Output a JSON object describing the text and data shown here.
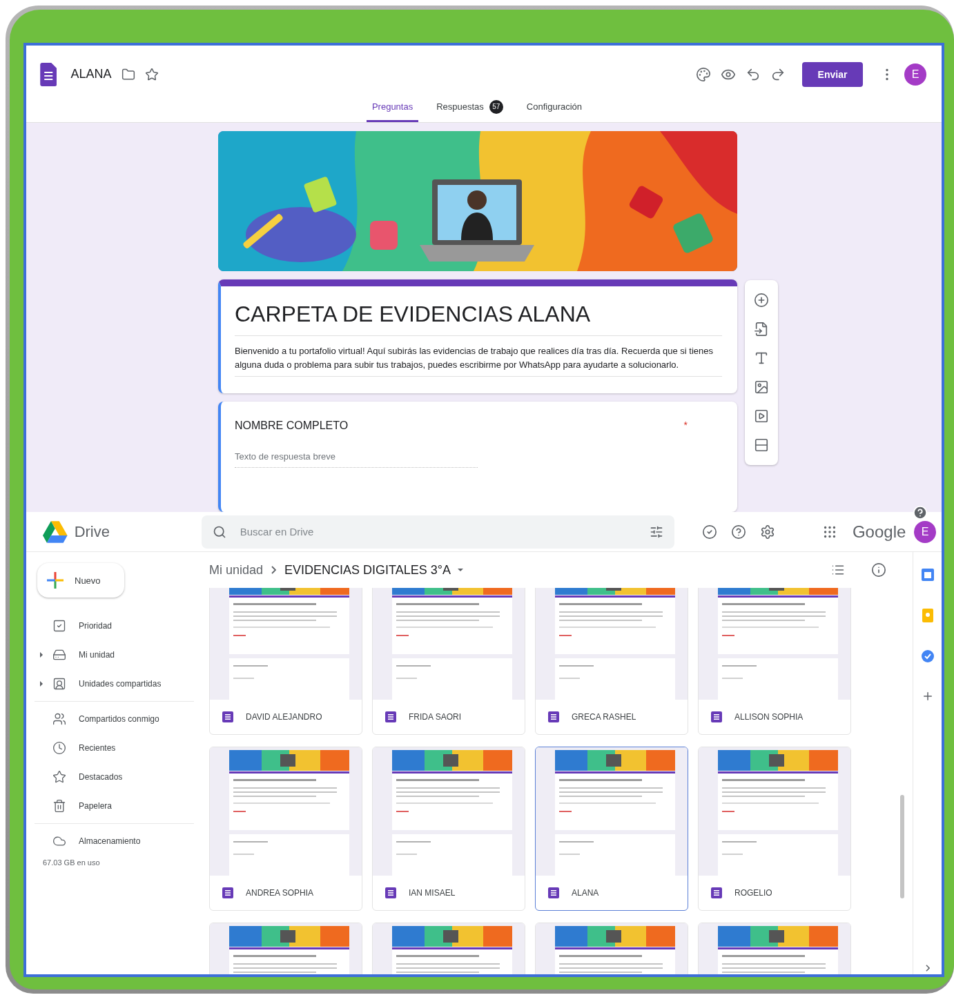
{
  "forms": {
    "title": "ALANA",
    "send_button": "Enviar",
    "avatar": "E",
    "tabs": [
      {
        "label": "Preguntas",
        "selected": true
      },
      {
        "label": "Respuestas",
        "badge": "57",
        "selected": false
      },
      {
        "label": "Configuración",
        "selected": false
      }
    ],
    "form_title": "CARPETA DE EVIDENCIAS ALANA",
    "form_description": "Bienvenido a tu portafolio virtual! Aquí subirás las evidencias de trabajo que realices día tras día. Recuerda que si tienes alguna duda o problema para subir tus trabajos, puedes escribirme por WhatsApp para ayudarte a solucionarlo.",
    "question": {
      "title": "NOMBRE COMPLETO",
      "required_mark": "*",
      "placeholder": "Texto de respuesta breve"
    }
  },
  "drive": {
    "brand": "Drive",
    "search": {
      "placeholder": "Buscar en Drive"
    },
    "google": "Google",
    "avatar": "E",
    "new_button": "Nuevo",
    "sidebar": [
      [
        {
          "label": "Prioridad",
          "expandable": false
        },
        {
          "label": "Mi unidad",
          "expandable": true
        },
        {
          "label": "Unidades compartidas",
          "expandable": true
        }
      ],
      [
        {
          "label": "Compartidos conmigo",
          "expandable": false
        },
        {
          "label": "Recientes",
          "expandable": false
        },
        {
          "label": "Destacados",
          "expandable": false
        },
        {
          "label": "Papelera",
          "expandable": false
        }
      ],
      [
        {
          "label": "Almacenamiento",
          "expandable": false
        }
      ]
    ],
    "storage": "67.03 GB en uso",
    "breadcrumb": [
      "Mi unidad",
      "EVIDENCIAS DIGITALES 3°A"
    ],
    "files": [
      {
        "name": "DAVID ALEJANDRO",
        "selected": false
      },
      {
        "name": "FRIDA SAORI",
        "selected": false
      },
      {
        "name": "GRECA RASHEL",
        "selected": false
      },
      {
        "name": "ALLISON SOPHIA",
        "selected": false
      },
      {
        "name": "ANDREA SOPHIA",
        "selected": false
      },
      {
        "name": "IAN MISAEL",
        "selected": false
      },
      {
        "name": "ALANA",
        "selected": true
      },
      {
        "name": "ROGELIO",
        "selected": false
      },
      {
        "selected": false
      },
      {
        "selected": false
      },
      {
        "selected": false
      },
      {
        "selected": false
      }
    ]
  }
}
